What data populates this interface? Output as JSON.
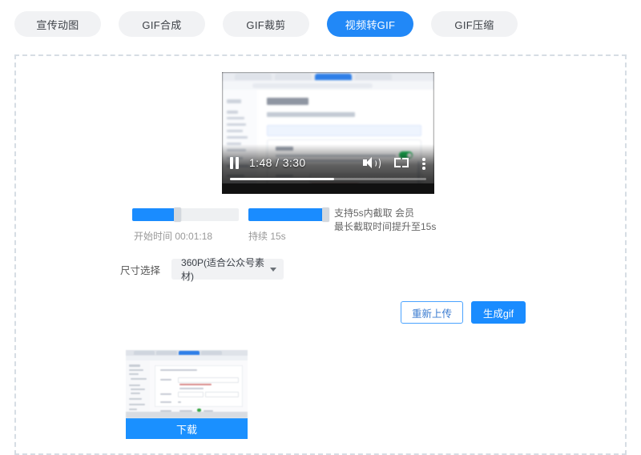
{
  "tabs": [
    {
      "label": "宣传动图",
      "active": false
    },
    {
      "label": "GIF合成",
      "active": false
    },
    {
      "label": "GIF裁剪",
      "active": false
    },
    {
      "label": "视频转GIF",
      "active": true
    },
    {
      "label": "GIF压缩",
      "active": false
    }
  ],
  "player": {
    "current_time": "1:48",
    "duration": "3:30",
    "time_display": "1:48 / 3:30",
    "pause_icon": "pause-icon",
    "volume_icon": "volume-icon",
    "fullscreen_icon": "fullscreen-icon",
    "more_icon": "more-options-icon",
    "progress_percent": 53
  },
  "trim": {
    "start_label": "开始时间",
    "start_value": "00:01:18",
    "start_line": "开始时间  00:01:18",
    "duration_label": "持续",
    "duration_value": "15s",
    "duration_line": "持续  15s",
    "hint_line1": "支持5s内截取 会员",
    "hint_line2": "最长截取时间提升至15s"
  },
  "size": {
    "label": "尺寸选择",
    "selected": "360P(适合公众号素材)",
    "caret_icon": "chevron-down-icon"
  },
  "actions": {
    "reupload_label": "重新上传",
    "generate_label": "生成gif"
  },
  "result": {
    "download_label": "下载"
  },
  "colors": {
    "accent": "#1a8cff",
    "tab_active": "#2188f7",
    "tab_inactive_bg": "#f1f2f4",
    "dashed_border": "#d6dde4",
    "muted_text": "#999999"
  }
}
